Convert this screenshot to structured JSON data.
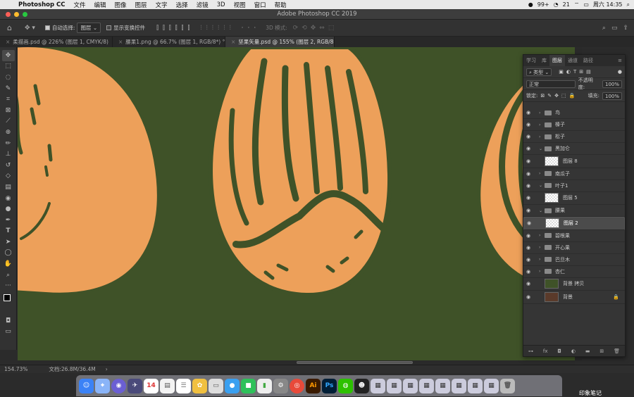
{
  "menubar": {
    "app": "Photoshop CC",
    "items": [
      "文件",
      "编辑",
      "图像",
      "图层",
      "文字",
      "选择",
      "滤镜",
      "3D",
      "视图",
      "窗口",
      "帮助"
    ],
    "status": {
      "badge": "99+",
      "num": "21",
      "clock": "周六 14:35"
    }
  },
  "window_title": "Adobe Photoshop CC 2019",
  "options": {
    "auto_select_label": "自动选择:",
    "auto_select_value": "图层",
    "show_transform_label": "显示变换控件",
    "mode_3d": "3D 模式:"
  },
  "tabs": [
    {
      "label": "柔描画.psd @ 226% (图层 1, CMYK/8)"
    },
    {
      "label": "腰果1.png @ 66.7% (图层 1, RGB/8*) °"
    },
    {
      "label": "坚果矢量.psd @ 155% (图层 2, RGB/8)"
    }
  ],
  "status": {
    "zoom": "154.73%",
    "doc": "文档:26.8M/36.4M",
    "more": "›"
  },
  "panel": {
    "tabs": [
      "学习",
      "库",
      "图层",
      "通道",
      "路径"
    ],
    "kind_filter": "类型",
    "blend_mode": "正常",
    "opacity_label": "不透明度:",
    "opacity_value": "100%",
    "lock_label": "锁定:",
    "fill_label": "填充:",
    "fill_value": "100%",
    "layers": [
      {
        "name": "鸟",
        "type": "group",
        "open": false
      },
      {
        "name": "榛子",
        "type": "group",
        "open": false
      },
      {
        "name": "松子",
        "type": "group",
        "open": false
      },
      {
        "name": "黑加仑",
        "type": "group",
        "open": true
      },
      {
        "name": "图层 8",
        "type": "layer",
        "thumb": "checker"
      },
      {
        "name": "南瓜子",
        "type": "group",
        "open": false
      },
      {
        "name": "叶子1",
        "type": "group",
        "open": true
      },
      {
        "name": "图层 5",
        "type": "layer",
        "thumb": "checker"
      },
      {
        "name": "腰果",
        "type": "group",
        "open": true
      },
      {
        "name": "图层 2",
        "type": "layer",
        "thumb": "checker",
        "selected": true
      },
      {
        "name": "碧根果",
        "type": "group",
        "open": false
      },
      {
        "name": "开心果",
        "type": "group",
        "open": false
      },
      {
        "name": "巴旦木",
        "type": "group",
        "open": false
      },
      {
        "name": "杏仁",
        "type": "group",
        "open": false
      },
      {
        "name": "背景 拷贝",
        "type": "layer",
        "thumb": "green"
      },
      {
        "name": "背景",
        "type": "layer",
        "thumb": "brown",
        "locked": true
      }
    ]
  },
  "dock": {
    "label": "印象笔记"
  },
  "colors": {
    "canvas_bg": "#3f5228",
    "nut_fill": "#eda05a",
    "nut_stroke": "#3f5228",
    "highlight_red": "#e05050"
  }
}
